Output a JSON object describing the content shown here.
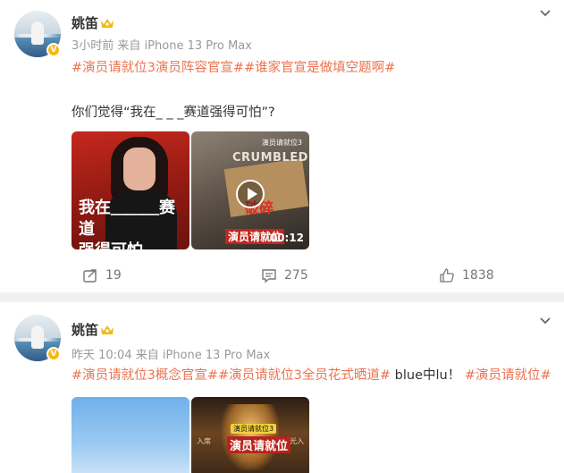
{
  "posts": [
    {
      "author": "姚笛",
      "verified_mark": "V",
      "time": "3小时前",
      "source": "来自 iPhone 13 Pro Max",
      "tags": [
        "#演员请就位3演员阵容官宣#",
        "#谁家官宣是做填空题啊#"
      ],
      "body": "你们觉得“我在_ _ _赛道强得可怕”?",
      "image_caption_line1": "我在＿＿＿赛道",
      "image_caption_line2": "强得可怕。",
      "video_word": "CRUMBLED",
      "video_red_text": "破碎",
      "video_logo_small": "演员请就位3",
      "video_logo": "演员请就位",
      "video_duration": "00:12",
      "repost_count": "19",
      "comment_count": "275",
      "like_count": "1838"
    },
    {
      "author": "姚笛",
      "verified_mark": "V",
      "time": "昨天 10:04",
      "source": "来自 iPhone 13 Pro Max",
      "tags": [
        "#演员请就位3概念官宣#",
        "#演员请就位3全员花式晒道#",
        "#演员请就位#"
      ],
      "mid_text": " blue中lu！ ",
      "image_badge": "演员请就位3",
      "image_title": "演员请就位",
      "image_side_left": "入席",
      "image_side_right": "光入"
    }
  ],
  "colors": {
    "tag": "#eb7350",
    "gold": "#f5b818",
    "meta": "#999999"
  },
  "icons": [
    "crown-icon",
    "chevron-down-icon",
    "repost-icon",
    "comment-icon",
    "like-icon",
    "play-icon"
  ]
}
